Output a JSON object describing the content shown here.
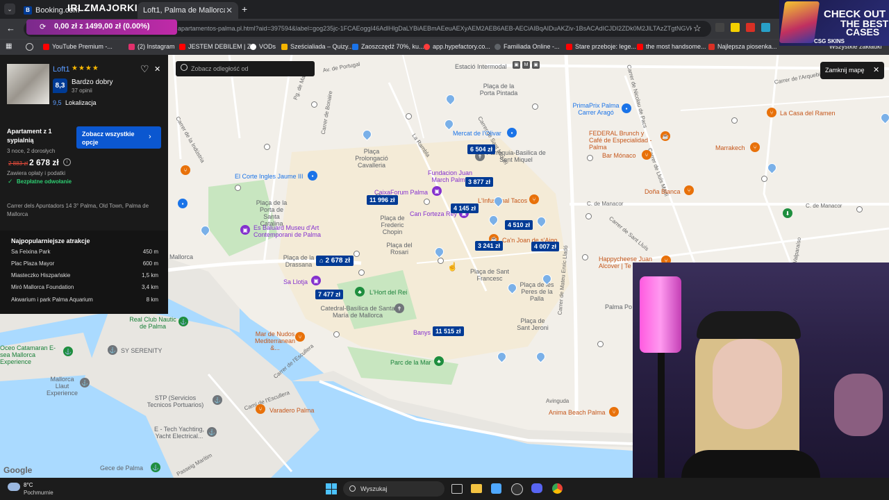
{
  "browser": {
    "tabs": [
      {
        "label": "Booking.com"
      },
      {
        "label": "Loft1, Palma de Mallorca (aktua"
      }
    ],
    "overlay_brand": "IRLZMAJORKI",
    "balance_display": "0,00 zł z 1499,00 zł (0.00%)",
    "url": "apartamentos-palma.pl.html?aid=397594&label=gog235jc-1FCAEoggI46AdIHlgDaLYBiAEBmAEeuAEXyAEM2AEB6AEB-AECiAIBqAIDuAKZiv-1BsACAdICJDI2ZDk0M2JlLTAzZTgtNGVk...",
    "bookmarks": [
      {
        "label": "YouTube Premium -...",
        "color": "#ff0000"
      },
      {
        "label": "(2) Instagram",
        "color": "#e1306c"
      },
      {
        "label": "JESTEM DEBILEM | Z...",
        "color": "#ff0000"
      },
      {
        "label": "VODs",
        "color": "#ffffff"
      },
      {
        "label": "Sześcialiada – Quizy...",
        "color": "#f4b400"
      },
      {
        "label": "Zaoszczędź 70%, ku...",
        "color": "#1a73e8"
      },
      {
        "label": "app.hypefactory.co...",
        "color": "#ff3b3b"
      },
      {
        "label": "Familiada Online -...",
        "color": "#5f6368"
      },
      {
        "label": "Stare przeboje: lege...",
        "color": "#ff0000"
      },
      {
        "label": "the most handsome...",
        "color": "#ff0000"
      },
      {
        "label": "Najlepsza piosenka...",
        "color": "#d93025"
      }
    ],
    "all_bookmarks": "Wszystkie zakładki"
  },
  "promo": {
    "line1": "CHECK OUT",
    "line2": "THE BEST",
    "line3": "CASES",
    "brand": "CSG SKINS"
  },
  "property": {
    "name": "Loft1",
    "stars": "★★★★",
    "score": "8,3",
    "score_label": "Bardzo dobry",
    "reviews": "37 opinii",
    "location_score": "9,5",
    "location_label": "Lokalizacja",
    "apt_type": "Apartament z 1 sypialnią",
    "stay": "3 noce, 2 dorosłych",
    "old_price": "2 883 zł",
    "price": "2 678 zł",
    "fees": "Zawiera opłaty i podatki",
    "cancel": "Bezpłatne odwołanie",
    "cta": "Zobacz wszystkie opcje",
    "address": "Carrer dels Apuntadors 14 3° Palma, Old Town, Palma de Mallorca",
    "attractions_title": "Najpopularniejsze atrakcje",
    "attractions": [
      {
        "name": "Sa Feixina Park",
        "dist": "450 m"
      },
      {
        "name": "Plac Plaza Mayor",
        "dist": "600 m"
      },
      {
        "name": "Miasteczko Hiszpańskie",
        "dist": "1,5 km"
      },
      {
        "name": "Miró Mallorca Foundation",
        "dist": "3,4 km"
      },
      {
        "name": "Akwarium i park Palma Aquarium",
        "dist": "8 km"
      }
    ]
  },
  "map": {
    "search_placeholder": "Zobacz odległość od",
    "close_label": "Zamknij mapę",
    "prices": [
      {
        "label": "6 504 zł"
      },
      {
        "label": "3 877 zł"
      },
      {
        "label": "11 996 zł"
      },
      {
        "label": "4 145 zł"
      },
      {
        "label": "4 510 zł"
      },
      {
        "label": "3 241 zł"
      },
      {
        "label": "4 007 zł"
      },
      {
        "label": "2 678 zł"
      },
      {
        "label": "7 477 zł"
      },
      {
        "label": "11 515 zł"
      }
    ],
    "places": [
      {
        "label": "Estació Intermodal"
      },
      {
        "label": "Plaça de la Porta Pintada"
      },
      {
        "label": "PrimaPrix Palma Carrer Aragó"
      },
      {
        "label": "La Casa del Ramen"
      },
      {
        "label": "Mercat de l'Olivar"
      },
      {
        "label": "FEDERAL Brunch y Café de Especialidad - Palma"
      },
      {
        "label": "Marrakech"
      },
      {
        "label": "Plaça Prolongació Cavalleria"
      },
      {
        "label": "Parroquia-Basilica de Sant Miquel"
      },
      {
        "label": "Bar Mónaco"
      },
      {
        "label": "El Corte Ingles Jaume III"
      },
      {
        "label": "Fundacion Juan March Palma"
      },
      {
        "label": "CaixaForum Palma"
      },
      {
        "label": "Doña Blanca"
      },
      {
        "label": "L'Infusional Tacos"
      },
      {
        "label": "Plaça de la Porta de Santa Catalina"
      },
      {
        "label": "Can Forteza Rey"
      },
      {
        "label": "Plaça de Frederic Chopin"
      },
      {
        "label": "Es Baluard Museu d'Art Contemporani de Palma"
      },
      {
        "label": "Ca'n Joan de s'Aigo"
      },
      {
        "label": "Plaça del Rosari"
      },
      {
        "label": "Plaça de la Drassana"
      },
      {
        "label": "Happycheese Juan Alcover | Te"
      },
      {
        "label": "Plaça de Sant Francesc"
      },
      {
        "label": "Sa Llotja"
      },
      {
        "label": "L'Hort del Rei"
      },
      {
        "label": "Plaça de les Peres de la Palla"
      },
      {
        "label": "Palma Po"
      },
      {
        "label": "Catedral-Basílica de Santa María de Mallorca"
      },
      {
        "label": "Real Club Nautic de Palma"
      },
      {
        "label": "Plaça de Sant Jeroni"
      },
      {
        "label": "Mar de Nudos Mediterranean &..."
      },
      {
        "label": "Banys"
      },
      {
        "label": "Oceo Catamaran E-sea Mallorca Experience"
      },
      {
        "label": "SY SERENITY"
      },
      {
        "label": "Parc de la Mar"
      },
      {
        "label": "Mallorca Llaut Experience"
      },
      {
        "label": "STP (Servicios Tecnicos Portuarios)"
      },
      {
        "label": "Varadero Palma"
      },
      {
        "label": "Anima Beach Palma"
      },
      {
        "label": "E - Tech Yachting, Yacht Electrical..."
      },
      {
        "label": "Gece de Palma"
      },
      {
        "label": "Mallorca"
      }
    ],
    "streets": [
      {
        "label": "Av. de Portugal"
      },
      {
        "label": "C. de Manacor"
      },
      {
        "label": "C. de Manacor"
      },
      {
        "label": "Carrer de la Indústria"
      },
      {
        "label": "Carrer de Bonaire"
      },
      {
        "label": "Carrer de Sant Miquel"
      },
      {
        "label": "La Rambla"
      },
      {
        "label": "Carrer de Mateu Enric Lladó"
      },
      {
        "label": "Carrer de l'Escullera"
      },
      {
        "label": "Avinguda"
      },
      {
        "label": "Passeig Marítim"
      },
      {
        "label": "Carrer Valparaíso"
      },
      {
        "label": "Carrer de Nicolau de Pacs"
      },
      {
        "label": "Carrer de Lluís Martí"
      },
      {
        "label": "Carrer de l'Arquebisbe Aspàreg"
      },
      {
        "label": "Carrer de Sant Lluís"
      },
      {
        "label": "Camí de l'Escullera"
      },
      {
        "label": "Pg. de Mallorca"
      }
    ],
    "google": "Google"
  },
  "taskbar": {
    "temp": "8°C",
    "weather": "Pochmurnie",
    "search": "Wyszukaj"
  }
}
